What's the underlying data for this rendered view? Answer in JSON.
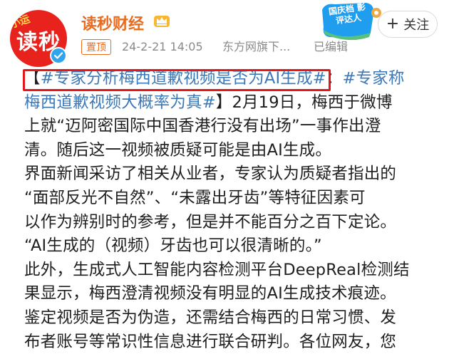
{
  "header": {
    "avatar_text": "读秒",
    "avatar_tag": "小运",
    "account_name": "读秒财经",
    "pin_label": "置顶",
    "timestamp": "24-2-21 14:05",
    "source": "东方网旗下...",
    "edited": "已编辑",
    "follow_label": "关注",
    "promo_text": "国庆档 影评达人"
  },
  "post": {
    "topic1": "#专家分析梅西道歉视频是否为AI生成#",
    "colon": "：",
    "topic2_line1": "#专家称",
    "topic2_line2": "梅西道歉视频大概率为真#",
    "l2_rest": "】2月19日，梅西于微博",
    "l3": "上就“迈阿密国际中国香港行没有出场”一事作出澄",
    "l4": "清。随后这一视频被质疑可能是由AI生成。",
    "l5": "界面新闻采访了相关从业者，专家认为质疑者指出的",
    "l6": "“面部反光不自然”、“未露出牙齿”等特征因素可",
    "l7": "以作为辨别时的参考，但是并不能百分之百下定论。",
    "l8": "“AI生成的（视频）牙齿也可以很清晰的。”",
    "l9": "此外，生成式人工智能内容检测平台DeepReal检测结",
    "l10": "果显示，梅西澄清视频没有明显的AI生成技术痕迹。",
    "l11": "鉴定视频是否为伪造，还需结合梅西的日常习惯、发",
    "l12": "布者账号等常识性信息进行联合研判。各位网友，您"
  },
  "colors": {
    "accent_orange": "#ea6a1e",
    "topic_blue": "#3b78b8",
    "highlight_red": "#e3181d",
    "avatar_red": "#e8231e",
    "verified_blue": "#2fa5ee"
  },
  "icons": [
    "verified-badge-icon",
    "crown-icon",
    "plus-icon",
    "promo-sticker-icon"
  ]
}
